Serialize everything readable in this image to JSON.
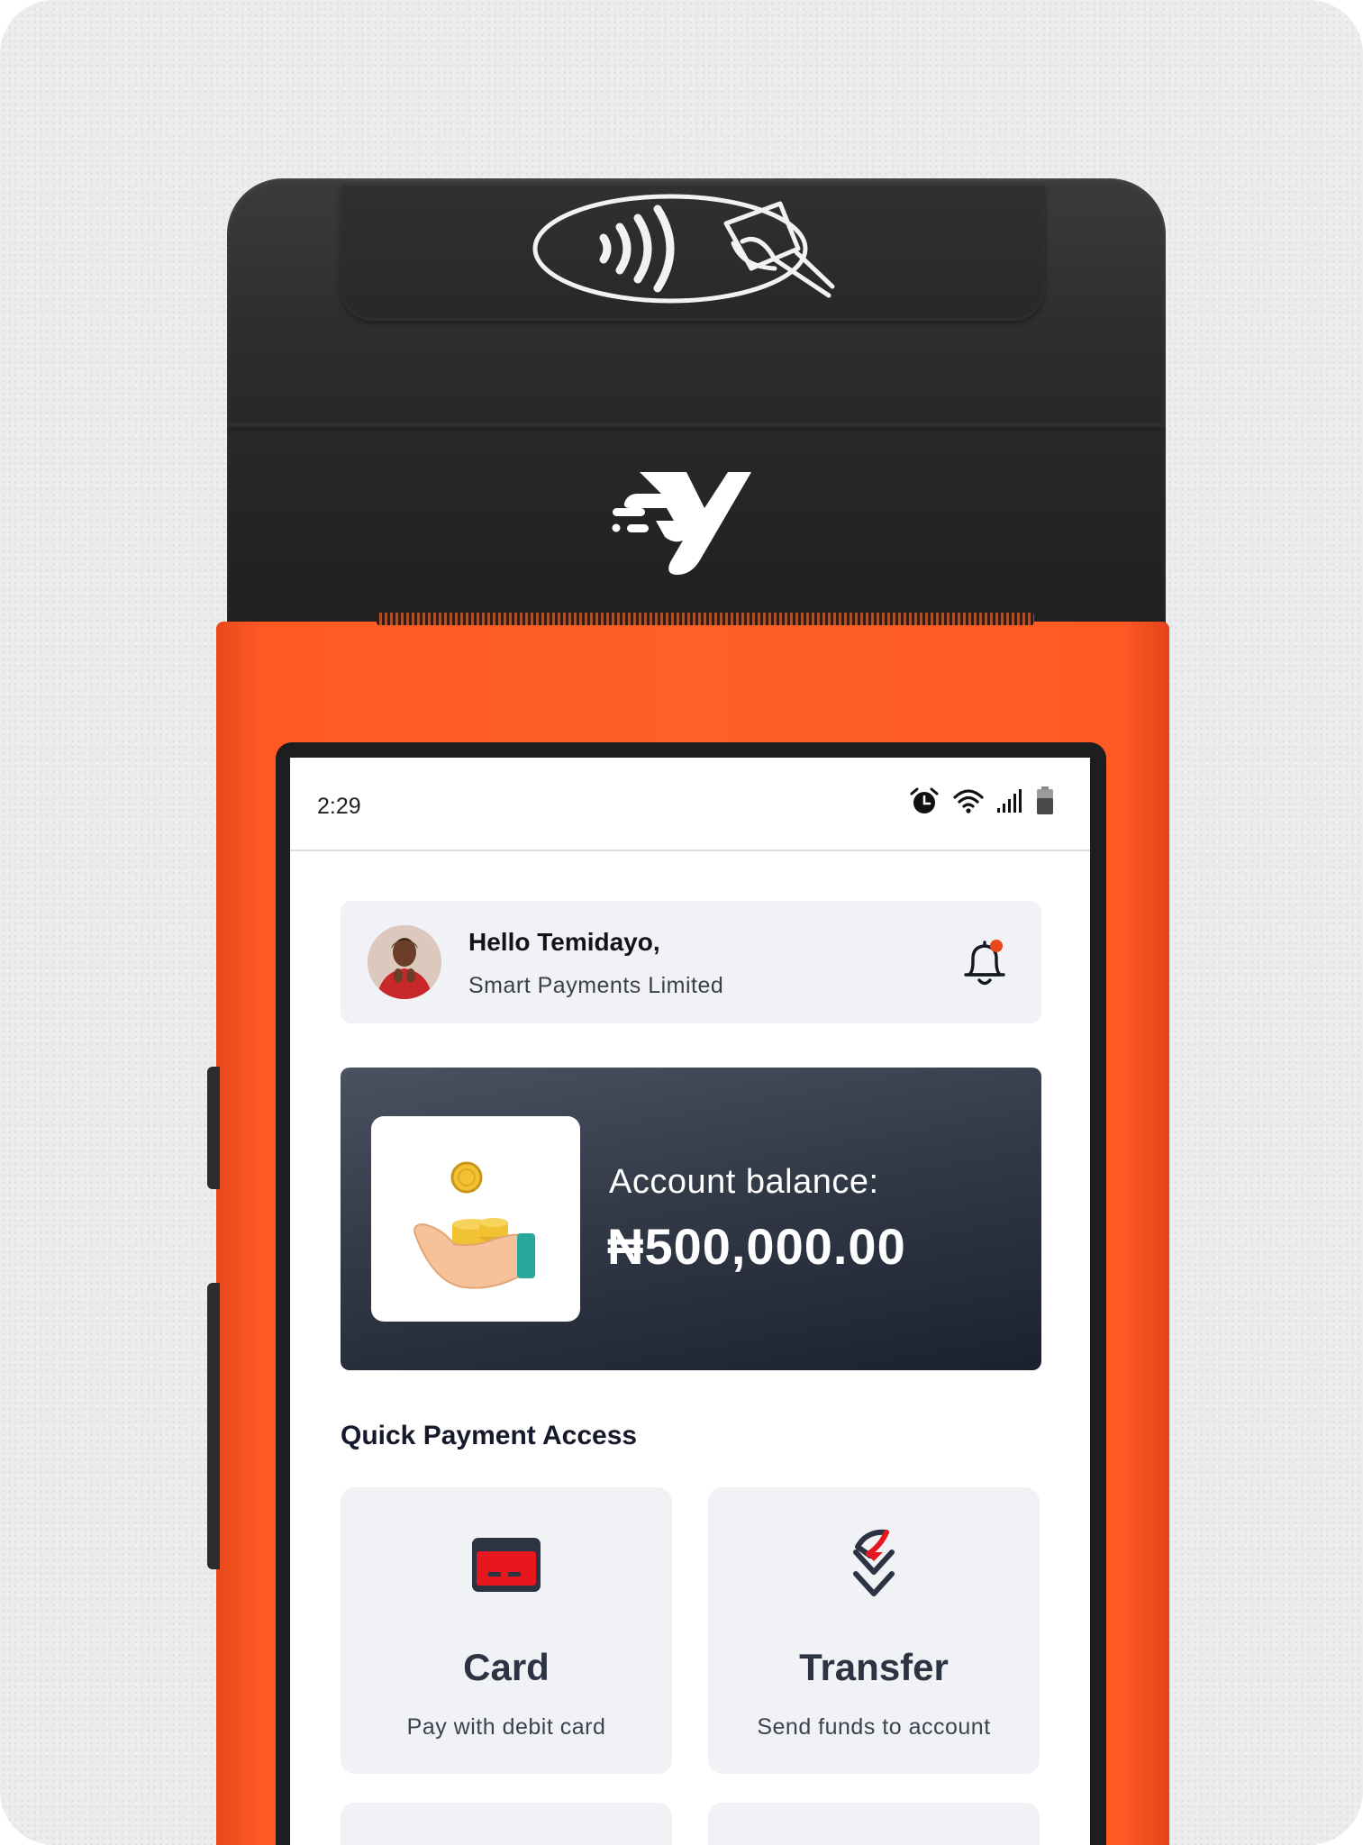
{
  "status_bar": {
    "time": "2:29",
    "icons": [
      "alarm-icon",
      "wifi-icon",
      "signal-icon",
      "battery-icon"
    ]
  },
  "greeting": {
    "title": "Hello Temidayo,",
    "subtitle": "Smart Payments Limited",
    "notification_indicator_color": "#e8481a"
  },
  "balance": {
    "label": "Account balance:",
    "amount": "₦500,000.00"
  },
  "quick_payment": {
    "title": "Quick Payment Access",
    "tiles": [
      {
        "title": "Card",
        "subtitle": "Pay with debit card",
        "icon": "credit-card-icon"
      },
      {
        "title": "Transfer",
        "subtitle": "Send funds to account",
        "icon": "transfer-icon"
      }
    ]
  },
  "colors": {
    "terminal_orange": "#ff5a24",
    "terminal_black": "#2a2b2d",
    "accent_red": "#e8171f",
    "navy": "#2c3343"
  }
}
